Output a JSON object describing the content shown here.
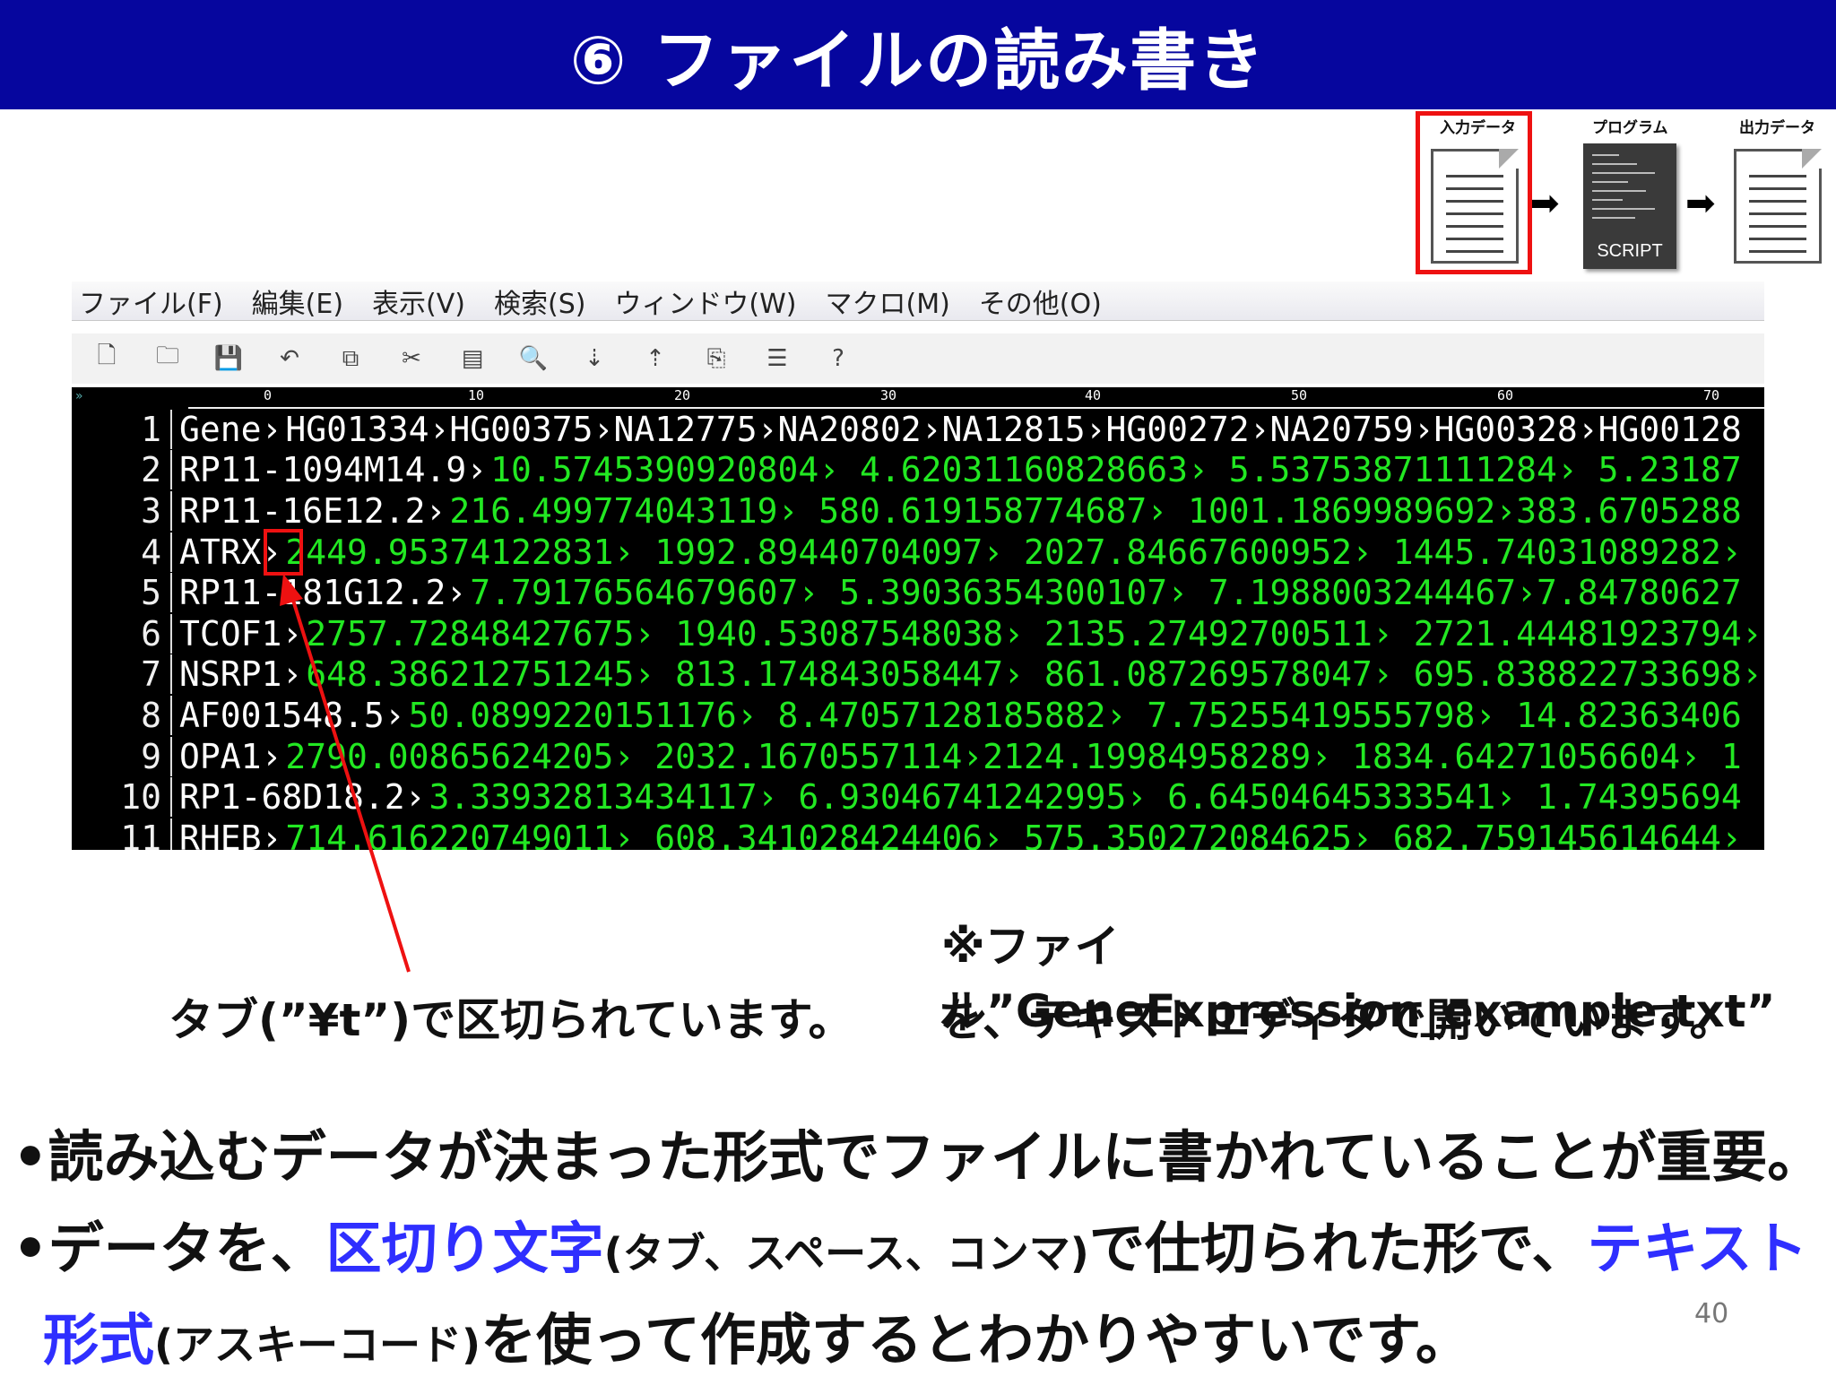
{
  "title": "⑥ ファイルの読み書き",
  "flow": {
    "input_label": "入力データ",
    "program_label": "プログラム",
    "output_label": "出力データ",
    "script_text": "SCRIPT"
  },
  "menu": [
    "ファイル(F)",
    "編集(E)",
    "表示(V)",
    "検索(S)",
    "ウィンドウ(W)",
    "マクロ(M)",
    "その他(O)"
  ],
  "ruler": [
    "0",
    "10",
    "20",
    "30",
    "40",
    "50",
    "60",
    "70"
  ],
  "rows": [
    {
      "n": "1",
      "gene": "Gene›",
      "vals": " HG01334›HG00375›NA12775›NA20802›NA12815›HG00272›NA20759›HG00328›HG00128"
    },
    {
      "n": "2",
      "gene": "RP11-1094M14.9›",
      "vals": " 10.5745390920804› 4.62031160828663› 5.53753871111284› 5.23187"
    },
    {
      "n": "3",
      "gene": "RP11-16E12.2›",
      "vals": " 216.499774043119› 580.619158774687› 1001.1869989692›383.6705288"
    },
    {
      "n": "4",
      "gene": "ATRX›",
      "vals": " 2449.95374122831› 1992.89440704097› 2027.84667600952› 1445.74031089282›"
    },
    {
      "n": "5",
      "gene": "RP11-181G12.2›",
      "vals": "7.79176564679607› 5.39036354300107› 7.1988003244467›7.84780627"
    },
    {
      "n": "6",
      "gene": "TCOF1›",
      "vals": "2757.72848427675› 1940.53087548038› 2135.27492700511› 2721.44481923794›"
    },
    {
      "n": "7",
      "gene": "NSRP1›",
      "vals": "648.386212751245› 813.174843058447› 861.087269578047› 695.838822733698›"
    },
    {
      "n": "8",
      "gene": "AF001548.5›",
      "vals": " 50.0899220151176› 8.47057128185882› 7.75255419555798› 14.82363406"
    },
    {
      "n": "9",
      "gene": "OPA1›",
      "vals": " 2790.00865624205› 2032.1670557114›2124.19984958289› 1834.64271056604› 1"
    },
    {
      "n": "10",
      "gene": "RP1-68D18.2›",
      "vals": "3.33932813434117› 6.93046741242995› 6.64504645333541› 1.74395694"
    },
    {
      "n": "11",
      "gene": "RHEB›",
      "vals": " 714.616220749011› 608.341028424406› 575.350272084625› 682.759145614644›"
    }
  ],
  "notes": {
    "tab_note": "タブ(”¥t”)で区切られています。",
    "file_note_1": "※ファイル”GeneExpression_example.txt”",
    "file_note_2": "を、テキストエディタで開いています。"
  },
  "bullets": {
    "b1": "•読み込むデータが決まった形式でファイルに書かれていることが重要。",
    "b2_pre": "•データを、",
    "b2_blue1": "区切り文字",
    "b2_paren": "(タブ、スペース、コンマ)",
    "b2_mid": "で仕切られた形で、",
    "b2_blue2": "テキスト",
    "b3_blue": "形式",
    "b3_paren": "(アスキーコード)",
    "b3_post": "を使って作成するとわかりやすいです。"
  },
  "page_number": "40",
  "colors": {
    "title_bg": "#06069e",
    "accent_blue": "#2f2fff",
    "highlight_red": "#ee1111",
    "editor_green": "#22e822"
  }
}
